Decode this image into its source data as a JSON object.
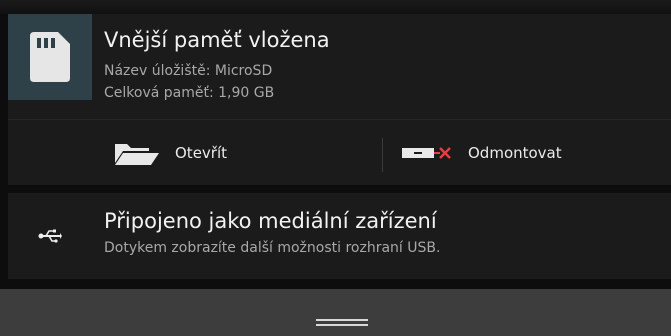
{
  "storage_notification": {
    "title": "Vnější paměť vložena",
    "storage_name": "Název úložiště: MicroSD",
    "total_memory": "Celková paměť: 1,90 GB",
    "icon": "sd-card-icon",
    "actions": [
      {
        "label": "Otevřít",
        "icon": "folder-icon"
      },
      {
        "label": "Odmontovat",
        "icon": "unmount-icon"
      }
    ]
  },
  "usb_notification": {
    "title": "Připojeno jako mediální zařízení",
    "description": "Dotykem zobrazíte další možnosti rozhraní USB.",
    "icon": "usb-icon"
  },
  "bottom_bar": {
    "icon": "drag-handle-icon"
  },
  "colors": {
    "notification_bg": "#1b1b1b",
    "icon_tile_bg": "#2e4148",
    "unmount_accent": "#e63d3d",
    "bottom_bar_bg": "#3d3d3d"
  }
}
